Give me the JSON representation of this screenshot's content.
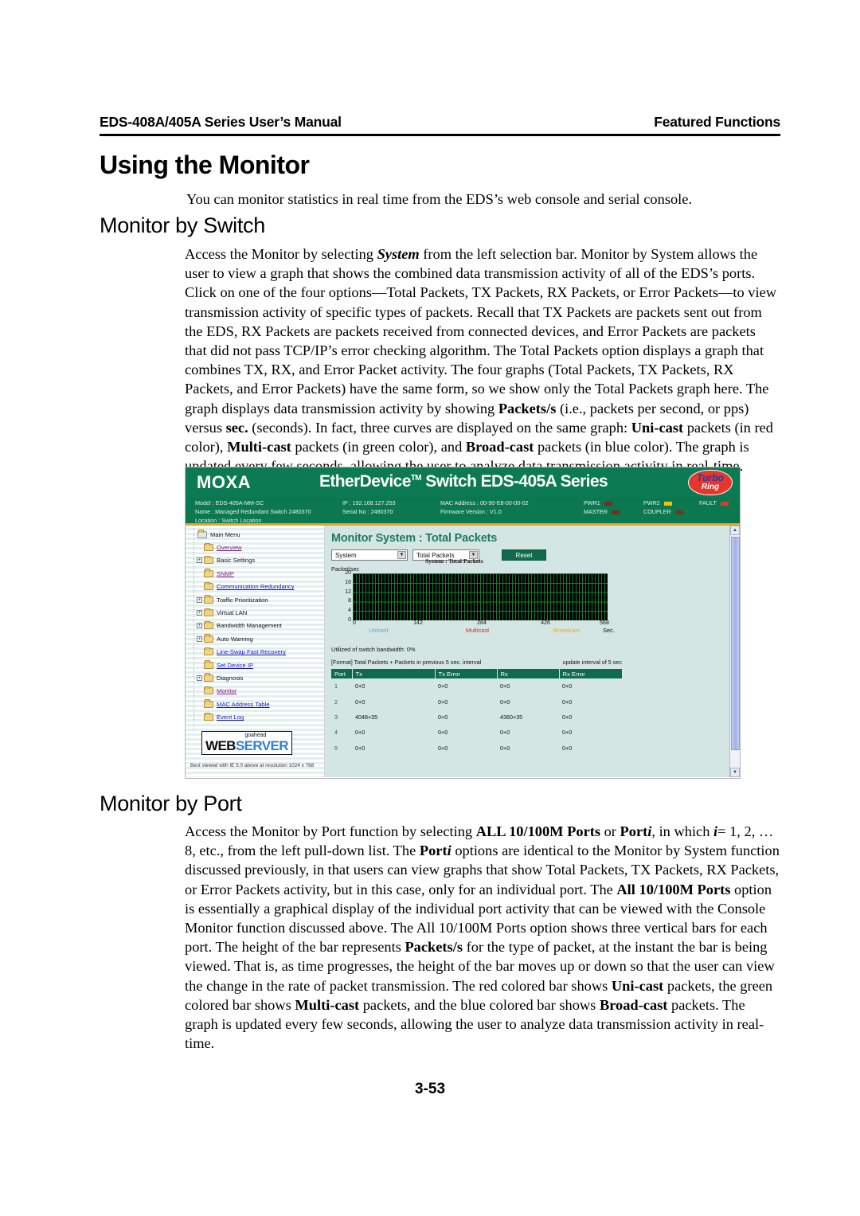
{
  "runhead": {
    "left": "EDS-408A/405A Series User’s Manual",
    "right": "Featured Functions"
  },
  "headings": {
    "h1": "Using the Monitor",
    "h2_switch": "Monitor by Switch",
    "h2_port": "Monitor by Port"
  },
  "paragraphs": {
    "intro": "You can monitor statistics in real time from the EDS’s web console and serial console."
  },
  "page_number": "3-53",
  "screenshot": {
    "banner": {
      "brand": "MOXA",
      "title_main": "EtherDevice",
      "title_sup": "TM",
      "title_rest": " Switch EDS-405A Series",
      "turbo_top": "Turbo",
      "turbo_bottom": "Ring"
    },
    "device_info": {
      "model_label": "Model :",
      "model_value": "EDS-405A-MM-SC",
      "name_label": "Name :",
      "name_value": "Managed Redundant Switch 2480370",
      "location_label": "Location :",
      "location_value": "Switch Location",
      "ip_label": "IP :",
      "ip_value": "192.168.127.253",
      "serial_label": "Serial No :",
      "serial_value": "2480370",
      "mac_label": "MAC Address :",
      "mac_value": "00-90-E8-00-00-02",
      "firmware_label": "Firmware Version :",
      "firmware_value": "V1.0",
      "leds": [
        {
          "label": "PWR1",
          "color": "#7a2a20"
        },
        {
          "label": "PWR2",
          "color": "#f2c400"
        },
        {
          "label": "FAULT",
          "color": "#e03b2a"
        },
        {
          "label": "MASTER",
          "color": "#7a2a20"
        },
        {
          "label": "COUPLER",
          "color": "#6e3a22"
        }
      ]
    },
    "nav": {
      "root": "Main Menu",
      "items": [
        {
          "label": "Overview",
          "style": "visited",
          "expander": false
        },
        {
          "label": "Basic Settings",
          "style": "plain",
          "expander": true
        },
        {
          "label": "SNMP",
          "style": "visited",
          "expander": false
        },
        {
          "label": "Communication Redundancy",
          "style": "link",
          "expander": false
        },
        {
          "label": "Traffic Prioritization",
          "style": "plain",
          "expander": true
        },
        {
          "label": "Virtual LAN",
          "style": "plain",
          "expander": true
        },
        {
          "label": "Bandwidth Management",
          "style": "plain",
          "expander": true
        },
        {
          "label": "Auto Warning",
          "style": "plain",
          "expander": true
        },
        {
          "label": "Line-Swap Fast Recovery",
          "style": "link",
          "expander": false
        },
        {
          "label": "Set Device IP",
          "style": "link",
          "expander": false
        },
        {
          "label": "Diagnosis",
          "style": "plain",
          "expander": true
        },
        {
          "label": "Monitor",
          "style": "visited",
          "expander": false
        },
        {
          "label": "MAC Address Table",
          "style": "link",
          "expander": false
        },
        {
          "label": "Event Log",
          "style": "link",
          "expander": false
        }
      ],
      "webserver_top": "goahead",
      "webserver_web": "WEB",
      "webserver_server": "SERVER",
      "footer": "Best viewed with IE 5.0 above at resolution 1024 x 768"
    },
    "content": {
      "title": "Monitor System : Total Packets",
      "select_scope": "System",
      "select_packet": "Total Packets",
      "reset_button": "Reset",
      "chart_caption": "System : Total Packets",
      "y_axis_label": "Packet/sec",
      "utilization": "Utilized of switch bandwidth:  0%",
      "format_note": "[Format] Total Packets + Packets in previous 5 sec. interval",
      "update_note": "update interval of 5 sec",
      "table": {
        "headers": [
          "Port",
          "Tx",
          "Tx Error",
          "Rx",
          "Rx Error"
        ],
        "rows": [
          [
            "1",
            "0+0",
            "0+0",
            "0+0",
            "0+0"
          ],
          [
            "2",
            "0+0",
            "0+0",
            "0+0",
            "0+0"
          ],
          [
            "3",
            "4048+35",
            "0+0",
            "4360+35",
            "0+0"
          ],
          [
            "4",
            "0+0",
            "0+0",
            "0+0",
            "0+0"
          ],
          [
            "5",
            "0+0",
            "0+0",
            "0+0",
            "0+0"
          ]
        ]
      }
    }
  },
  "chart_data": {
    "type": "line",
    "title": "System : Total Packets",
    "xlabel": "Sec.",
    "ylabel": "Packet/sec",
    "ylim": [
      0,
      20
    ],
    "yticks": [
      0,
      4,
      8,
      12,
      16,
      20
    ],
    "xlim": [
      0,
      568
    ],
    "xticks": [
      0,
      142,
      284,
      426,
      568
    ],
    "grid": true,
    "legend_position": "below",
    "series": [
      {
        "name": "Unicast",
        "color": "#4aa8ef",
        "values": []
      },
      {
        "name": "Multicast",
        "color": "#e8251c",
        "values": []
      },
      {
        "name": "Broadcast",
        "color": "#f0a81e",
        "values": []
      }
    ],
    "note": "All three traces are flat at 0 packets/sec across the visible window."
  }
}
